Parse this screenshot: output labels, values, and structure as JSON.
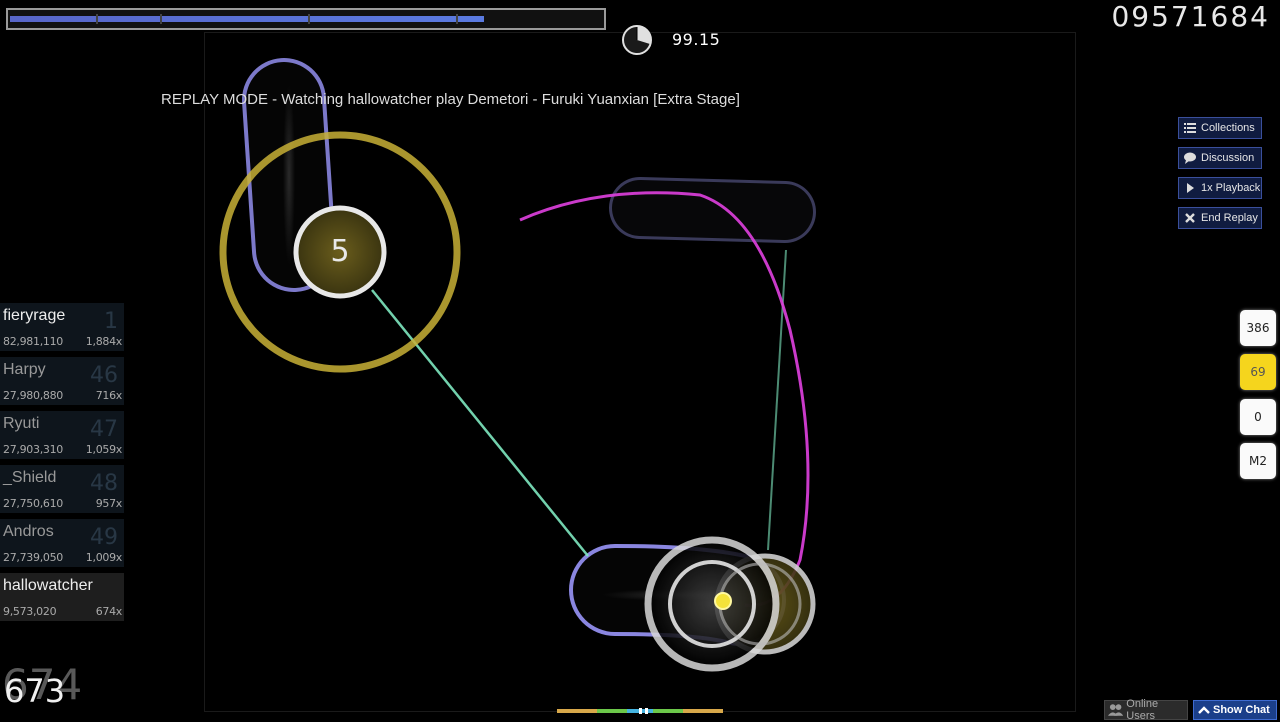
{
  "hud": {
    "health_fraction": 0.8,
    "accuracy": "99.15",
    "score": "09571684",
    "combo": "673",
    "combo_shadow": "674",
    "replay_text": "REPLAY MODE - Watching hallowatcher play Demetori - Furuki Yuanxian [Extra Stage]"
  },
  "side_buttons": [
    {
      "label": "Collections",
      "icon": "list-icon"
    },
    {
      "label": "Discussion",
      "icon": "chat-bubble-icon"
    },
    {
      "label": "1x Playback",
      "icon": "play-icon"
    },
    {
      "label": "End Replay",
      "icon": "close-icon"
    }
  ],
  "keys": [
    {
      "label": "386",
      "active": false
    },
    {
      "label": "69",
      "active": true
    },
    {
      "label": "0",
      "active": false
    },
    {
      "label": "M2",
      "active": false
    }
  ],
  "leaderboard": [
    {
      "name": "fieryrage",
      "score": "82,981,110",
      "combo": "1,884x",
      "rank": "1",
      "dim": false
    },
    {
      "name": "Harpy",
      "score": "27,980,880",
      "combo": "716x",
      "rank": "46",
      "dim": true
    },
    {
      "name": "Ryuti",
      "score": "27,903,310",
      "combo": "1,059x",
      "rank": "47",
      "dim": true
    },
    {
      "name": "_Shield",
      "score": "27,750,610",
      "combo": "957x",
      "rank": "48",
      "dim": true
    },
    {
      "name": "Andros",
      "score": "27,739,050",
      "combo": "1,009x",
      "rank": "49",
      "dim": true
    },
    {
      "name": "hallowatcher",
      "score": "9,573,020",
      "combo": "674x",
      "rank": "",
      "dim": false,
      "current": true
    }
  ],
  "hit_object": {
    "number": "5"
  },
  "bottom": {
    "online_users": "Online Users",
    "show_chat": "Show Chat"
  },
  "colors": {
    "slider_border": "#8a86e0",
    "approach_circle": "#c8b036",
    "cursor_trail": "#e040e0",
    "follow_line": "#7fe8c0",
    "hp_fill": "#5a70d8"
  }
}
